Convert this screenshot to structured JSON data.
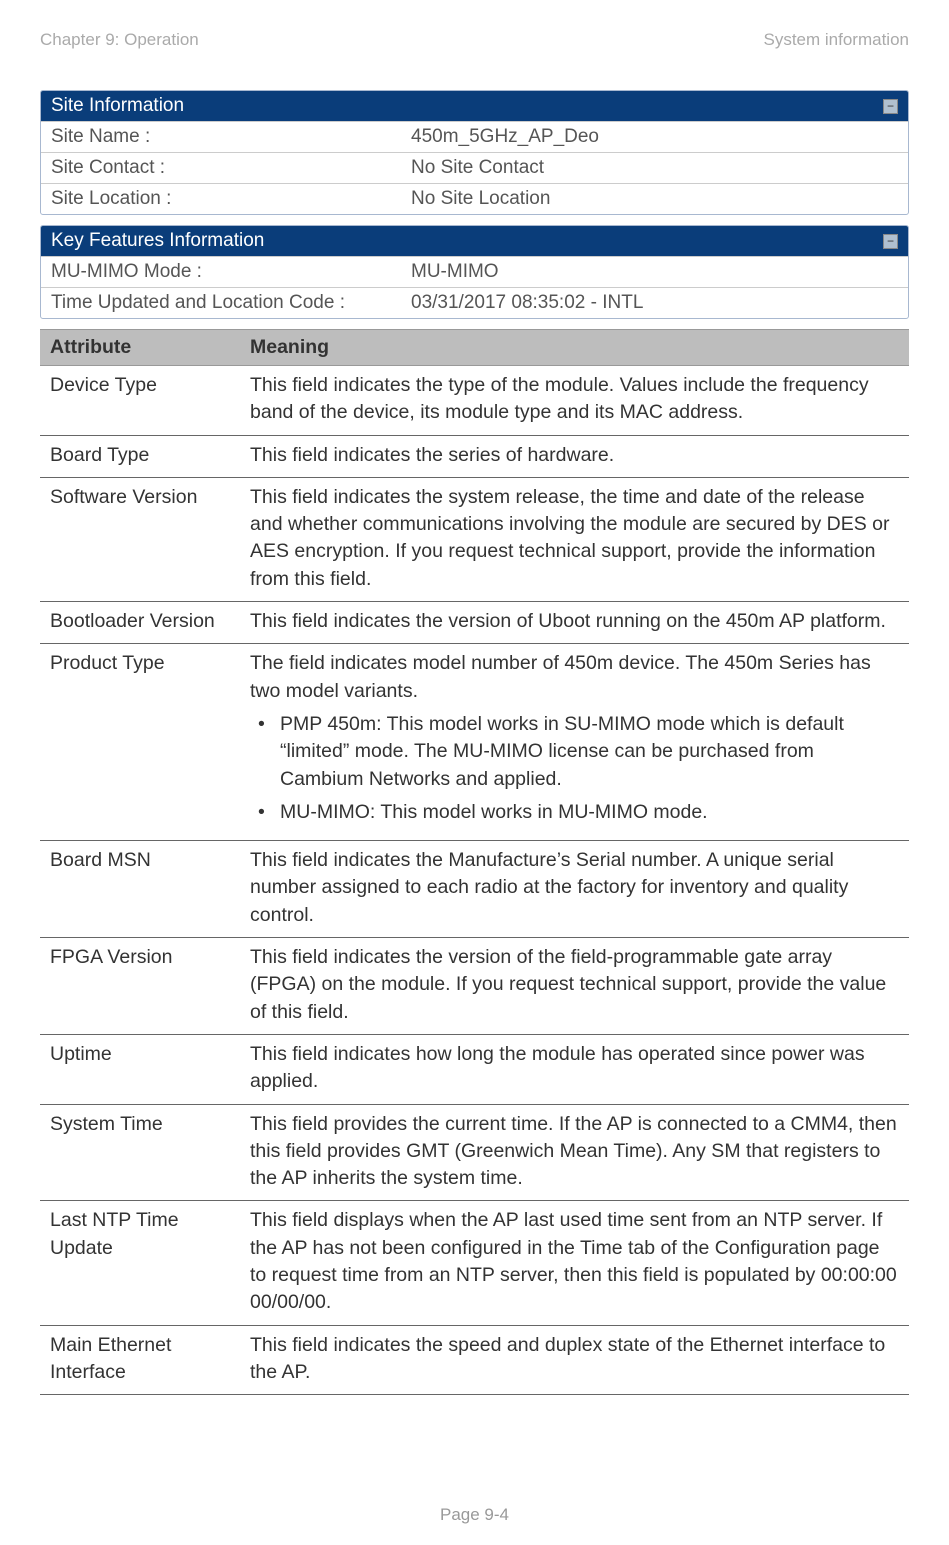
{
  "header": {
    "chapter": "Chapter 9:  Operation",
    "section": "System information"
  },
  "site_info": {
    "title": "Site Information",
    "rows": [
      {
        "label": "Site Name :",
        "value": "450m_5GHz_AP_Deo"
      },
      {
        "label": "Site Contact :",
        "value": "No Site Contact"
      },
      {
        "label": "Site Location :",
        "value": "No Site Location"
      }
    ]
  },
  "key_features": {
    "title": "Key Features Information",
    "rows": [
      {
        "label": "MU-MIMO Mode :",
        "value": "MU-MIMO"
      },
      {
        "label": "Time Updated and Location Code :",
        "value": "03/31/2017 08:35:02 - INTL"
      }
    ]
  },
  "attr_header": {
    "col1": "Attribute",
    "col2": "Meaning"
  },
  "attributes": [
    {
      "name": "Device Type",
      "meaning": "This field indicates the type of the module. Values include the frequency band of the device, its module type and its MAC address."
    },
    {
      "name": "Board Type",
      "meaning": "This field indicates the series of hardware."
    },
    {
      "name": "Software Version",
      "meaning": "This field indicates the system release, the time and date of the release and whether communications involving the module are secured by DES or AES encryption. If you request technical support, provide the information from this field."
    },
    {
      "name": "Bootloader Version",
      "meaning": "This field indicates the version of Uboot running on the 450m AP platform."
    },
    {
      "name": "Product Type",
      "meaning_intro": "The field indicates model number of 450m device. The 450m Series has two model variants.",
      "bullets": [
        "PMP 450m: This model works in SU-MIMO mode which is default “limited” mode. The MU-MIMO license can be purchased from Cambium Networks and applied.",
        "MU-MIMO: This model works in MU-MIMO mode."
      ]
    },
    {
      "name": "Board MSN",
      "meaning": "This field indicates the Manufacture’s Serial number. A unique serial number assigned to each radio at the factory for inventory and quality control."
    },
    {
      "name": "FPGA Version",
      "meaning": "This field indicates the version of the field-programmable gate array (FPGA) on the module. If you request technical support, provide the value of this field."
    },
    {
      "name": "Uptime",
      "meaning": "This field indicates how long the module has operated since power was applied."
    },
    {
      "name": "System Time",
      "meaning": "This field provides the current time. If the AP is connected to a CMM4, then this field provides GMT (Greenwich Mean Time). Any SM that registers to the AP inherits the system time."
    },
    {
      "name": "Last NTP Time Update",
      "meaning": "This field displays when the AP last used time sent from an NTP server. If the AP has not been configured in the Time tab of the Configuration page to request time from an NTP server, then this field is populated by 00:00:00 00/00/00."
    },
    {
      "name": "Main Ethernet Interface",
      "meaning": "This field indicates the speed and duplex state of the Ethernet interface to the AP."
    }
  ],
  "footer": {
    "page": "Page 9-4"
  },
  "collapse_glyph": "−"
}
